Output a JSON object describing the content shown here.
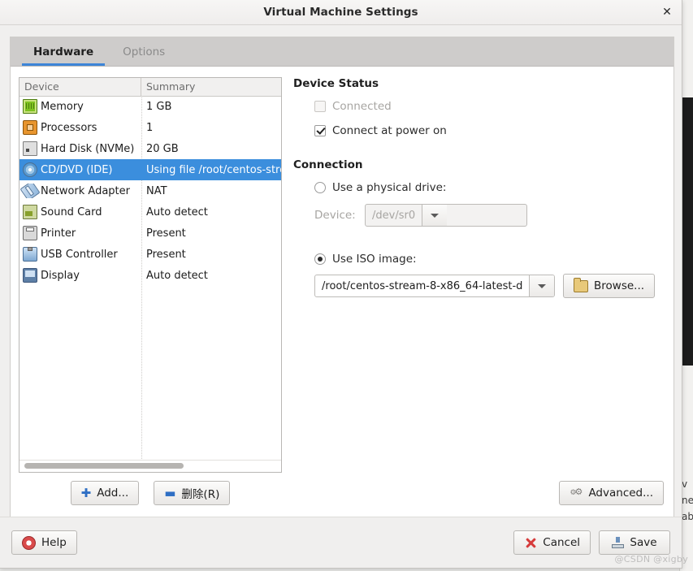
{
  "window": {
    "title": "Virtual Machine Settings",
    "close_icon": "close-icon",
    "close_glyph": "✕"
  },
  "tabs": [
    {
      "label": "Hardware",
      "active": true
    },
    {
      "label": "Options",
      "active": false
    }
  ],
  "device_list": {
    "columns": [
      "Device",
      "Summary"
    ],
    "rows": [
      {
        "icon": "memory-icon",
        "device": "Memory",
        "summary": "1 GB",
        "selected": false
      },
      {
        "icon": "processor-icon",
        "device": "Processors",
        "summary": "1",
        "selected": false
      },
      {
        "icon": "hard-disk-icon",
        "device": "Hard Disk (NVMe)",
        "summary": "20 GB",
        "selected": false
      },
      {
        "icon": "cd-dvd-icon",
        "device": "CD/DVD (IDE)",
        "summary": "Using file /root/centos-stre",
        "selected": true
      },
      {
        "icon": "network-adapter-icon",
        "device": "Network Adapter",
        "summary": "NAT",
        "selected": false
      },
      {
        "icon": "sound-card-icon",
        "device": "Sound Card",
        "summary": "Auto detect",
        "selected": false
      },
      {
        "icon": "printer-icon",
        "device": "Printer",
        "summary": "Present",
        "selected": false
      },
      {
        "icon": "usb-controller-icon",
        "device": "USB Controller",
        "summary": "Present",
        "selected": false
      },
      {
        "icon": "display-icon",
        "device": "Display",
        "summary": "Auto detect",
        "selected": false
      }
    ],
    "actions": {
      "add_label": "Add...",
      "add_icon": "plus-icon",
      "remove_label": "删除(R)",
      "remove_icon": "minus-icon"
    }
  },
  "device_status": {
    "title": "Device Status",
    "connected": {
      "label": "Connected",
      "checked": false,
      "disabled": true
    },
    "connect_at_power_on": {
      "label": "Connect at power on",
      "checked": true,
      "disabled": false
    }
  },
  "connection": {
    "title": "Connection",
    "physical_drive": {
      "label": "Use a physical drive:",
      "selected": false,
      "device_label": "Device:",
      "device_value": "/dev/sr0",
      "disabled": true
    },
    "iso_image": {
      "label": "Use ISO image:",
      "selected": true,
      "path_value": "/root/centos-stream-8-x86_64-latest-d",
      "browse_label": "Browse...",
      "browse_icon": "folder-icon"
    }
  },
  "advanced": {
    "label": "Advanced...",
    "icon": "gears-icon"
  },
  "footer": {
    "help": {
      "label": "Help",
      "icon": "help-icon"
    },
    "cancel": {
      "label": "Cancel",
      "icon": "cancel-icon"
    },
    "save": {
      "label": "Save",
      "icon": "save-icon"
    }
  },
  "watermark": "@CSDN @xigby",
  "background": {
    "right_edge_text": "v\nne\nab"
  },
  "colors": {
    "accent": "#3d85d8",
    "selection": "#3b8edd",
    "dialog_bg": "#f0efee",
    "tabstrip_bg": "#cecccb"
  }
}
